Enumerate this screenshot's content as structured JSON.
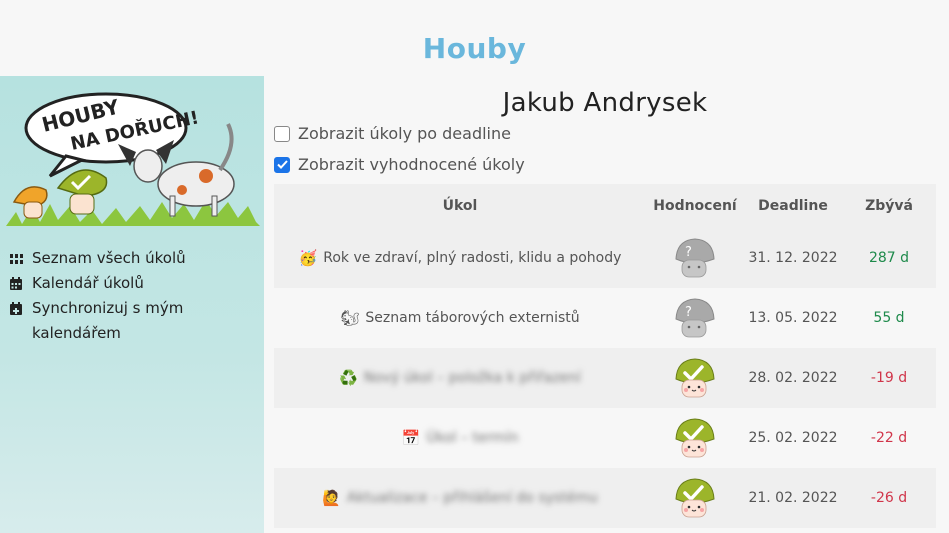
{
  "app": {
    "title": "Houby"
  },
  "sidebar": {
    "logo_text": [
      "HOUBY",
      "NA DOŘUCH!"
    ],
    "items": [
      {
        "label": "Seznam všech úkolů",
        "icon": "grid-icon"
      },
      {
        "label": "Kalendář úkolů",
        "icon": "calendar-icon"
      },
      {
        "label": "Synchronizuj s mým kalendářem",
        "icon": "calendar-plus-icon"
      }
    ]
  },
  "main": {
    "person": "Jakub Andrysek",
    "filters": [
      {
        "label": "Zobrazit úkoly po deadline",
        "checked": false
      },
      {
        "label": "Zobrazit vyhodnocené úkoly",
        "checked": true
      }
    ],
    "table": {
      "headers": {
        "task": "Úkol",
        "eval": "Hodnocení",
        "deadline": "Deadline",
        "left": "Zbývá"
      },
      "rows": [
        {
          "emoji": "🥳",
          "task": "Rok ve zdraví, plný radosti, klidu a pohody",
          "blurred": false,
          "eval": "unknown",
          "deadline": "31. 12. 2022",
          "left": "287 d",
          "status": "positive"
        },
        {
          "emoji": "🐿",
          "task": "Seznam táborových externistů",
          "blurred": false,
          "eval": "unknown",
          "deadline": "13. 05. 2022",
          "left": "55 d",
          "status": "positive"
        },
        {
          "emoji": "♻️",
          "task": "Nový úkol – položka k přiřazení",
          "blurred": true,
          "eval": "done",
          "deadline": "28. 02. 2022",
          "left": "-19 d",
          "status": "negative"
        },
        {
          "emoji": "📅",
          "task": "Úkol – termín",
          "blurred": true,
          "eval": "done",
          "deadline": "25. 02. 2022",
          "left": "-22 d",
          "status": "negative"
        },
        {
          "emoji": "🙋",
          "task": "Aktualizace – přihlášení do systému",
          "blurred": true,
          "eval": "done",
          "deadline": "21. 02. 2022",
          "left": "-26 d",
          "status": "negative"
        }
      ]
    }
  },
  "colors": {
    "title": "#6ab7dc",
    "positive": "#1e8a4b",
    "negative": "#d0354a",
    "checkbox": "#1b74e8"
  }
}
